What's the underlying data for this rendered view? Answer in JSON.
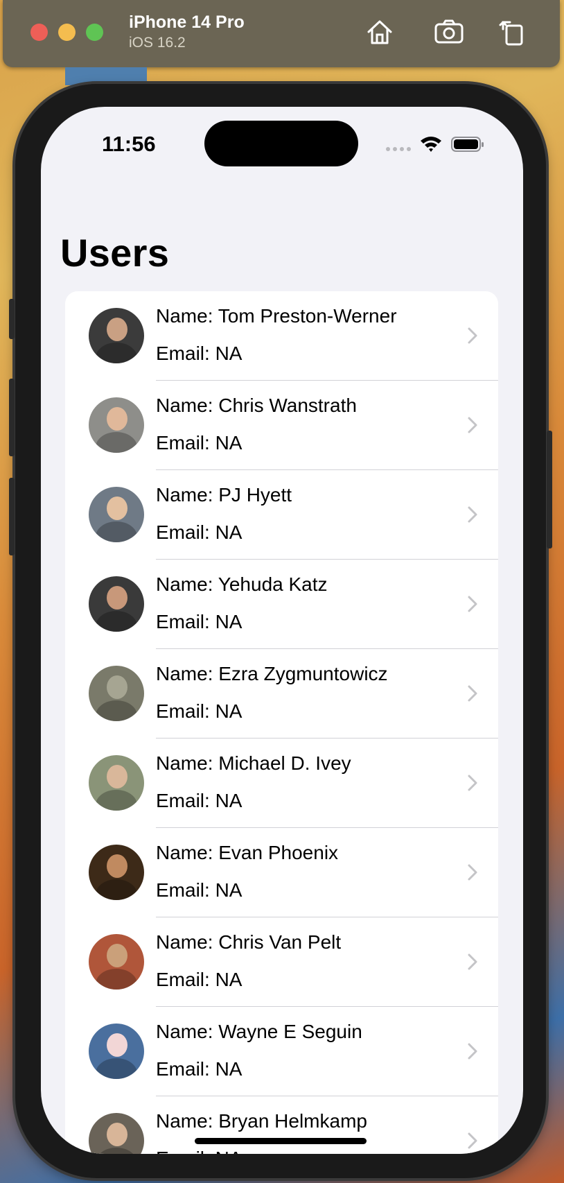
{
  "simulator": {
    "device": "iPhone 14 Pro",
    "os": "iOS 16.2",
    "icons": [
      "home-icon",
      "screenshot-icon",
      "rotate-icon"
    ]
  },
  "status_bar": {
    "time": "11:56",
    "icons": [
      "cellular-icon",
      "wifi-icon",
      "battery-icon"
    ]
  },
  "screen": {
    "title": "Users"
  },
  "users": [
    {
      "name": "Name: Tom Preston-Werner",
      "email": "Email: NA",
      "avatar_color": "#3b3b3b",
      "skin": "#c9a083"
    },
    {
      "name": "Name: Chris Wanstrath",
      "email": "Email: NA",
      "avatar_color": "#8e8e8a",
      "skin": "#e0b89a"
    },
    {
      "name": "Name: PJ Hyett",
      "email": "Email: NA",
      "avatar_color": "#6f7a86",
      "skin": "#e3c0a0"
    },
    {
      "name": "Name: Yehuda Katz",
      "email": "Email: NA",
      "avatar_color": "#3a3a3a",
      "skin": "#c8987a"
    },
    {
      "name": "Name: Ezra Zygmuntowicz",
      "email": "Email: NA",
      "avatar_color": "#7a7a6a",
      "skin": "#a6a592"
    },
    {
      "name": "Name: Michael D. Ivey",
      "email": "Email: NA",
      "avatar_color": "#8a9478",
      "skin": "#d9b79a"
    },
    {
      "name": "Name: Evan Phoenix",
      "email": "Email: NA",
      "avatar_color": "#3d2a18",
      "skin": "#c08a60"
    },
    {
      "name": "Name: Chris Van Pelt",
      "email": "Email: NA",
      "avatar_color": "#b0563a",
      "skin": "#caa07a"
    },
    {
      "name": "Name: Wayne E Seguin",
      "email": "Email: NA",
      "avatar_color": "#4a6f9e",
      "skin": "#f2d6d6"
    },
    {
      "name": "Name: Bryan Helmkamp",
      "email": "Email: NA",
      "avatar_color": "#6a6358",
      "skin": "#d8b598"
    }
  ],
  "colors": {
    "background": "#f2f2f7",
    "separator": "#d1d1d6",
    "chevron": "#c4c4c7"
  }
}
